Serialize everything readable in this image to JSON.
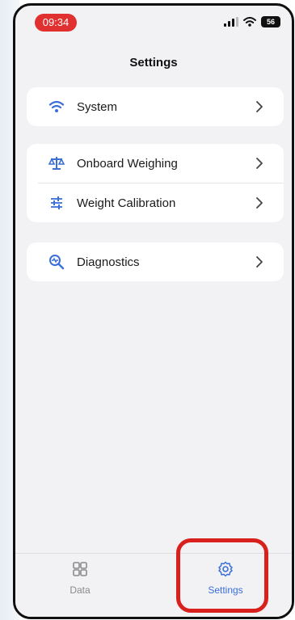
{
  "status_bar": {
    "time": "09:34",
    "battery": "56"
  },
  "header": {
    "title": "Settings"
  },
  "groups": [
    {
      "items": [
        {
          "label": "System",
          "icon": "wifi-icon"
        }
      ]
    },
    {
      "items": [
        {
          "label": "Onboard Weighing",
          "icon": "scale-icon"
        },
        {
          "label": "Weight Calibration",
          "icon": "sliders-icon"
        }
      ]
    },
    {
      "items": [
        {
          "label": "Diagnostics",
          "icon": "diagnostics-icon"
        }
      ]
    }
  ],
  "tabbar": {
    "tabs": [
      {
        "label": "Data",
        "icon": "grid-icon",
        "active": false
      },
      {
        "label": "Settings",
        "icon": "gear-icon",
        "active": true
      }
    ]
  },
  "colors": {
    "accent": "#3a6fd8",
    "highlight": "#d8201c",
    "time_pill": "#e0302f"
  }
}
